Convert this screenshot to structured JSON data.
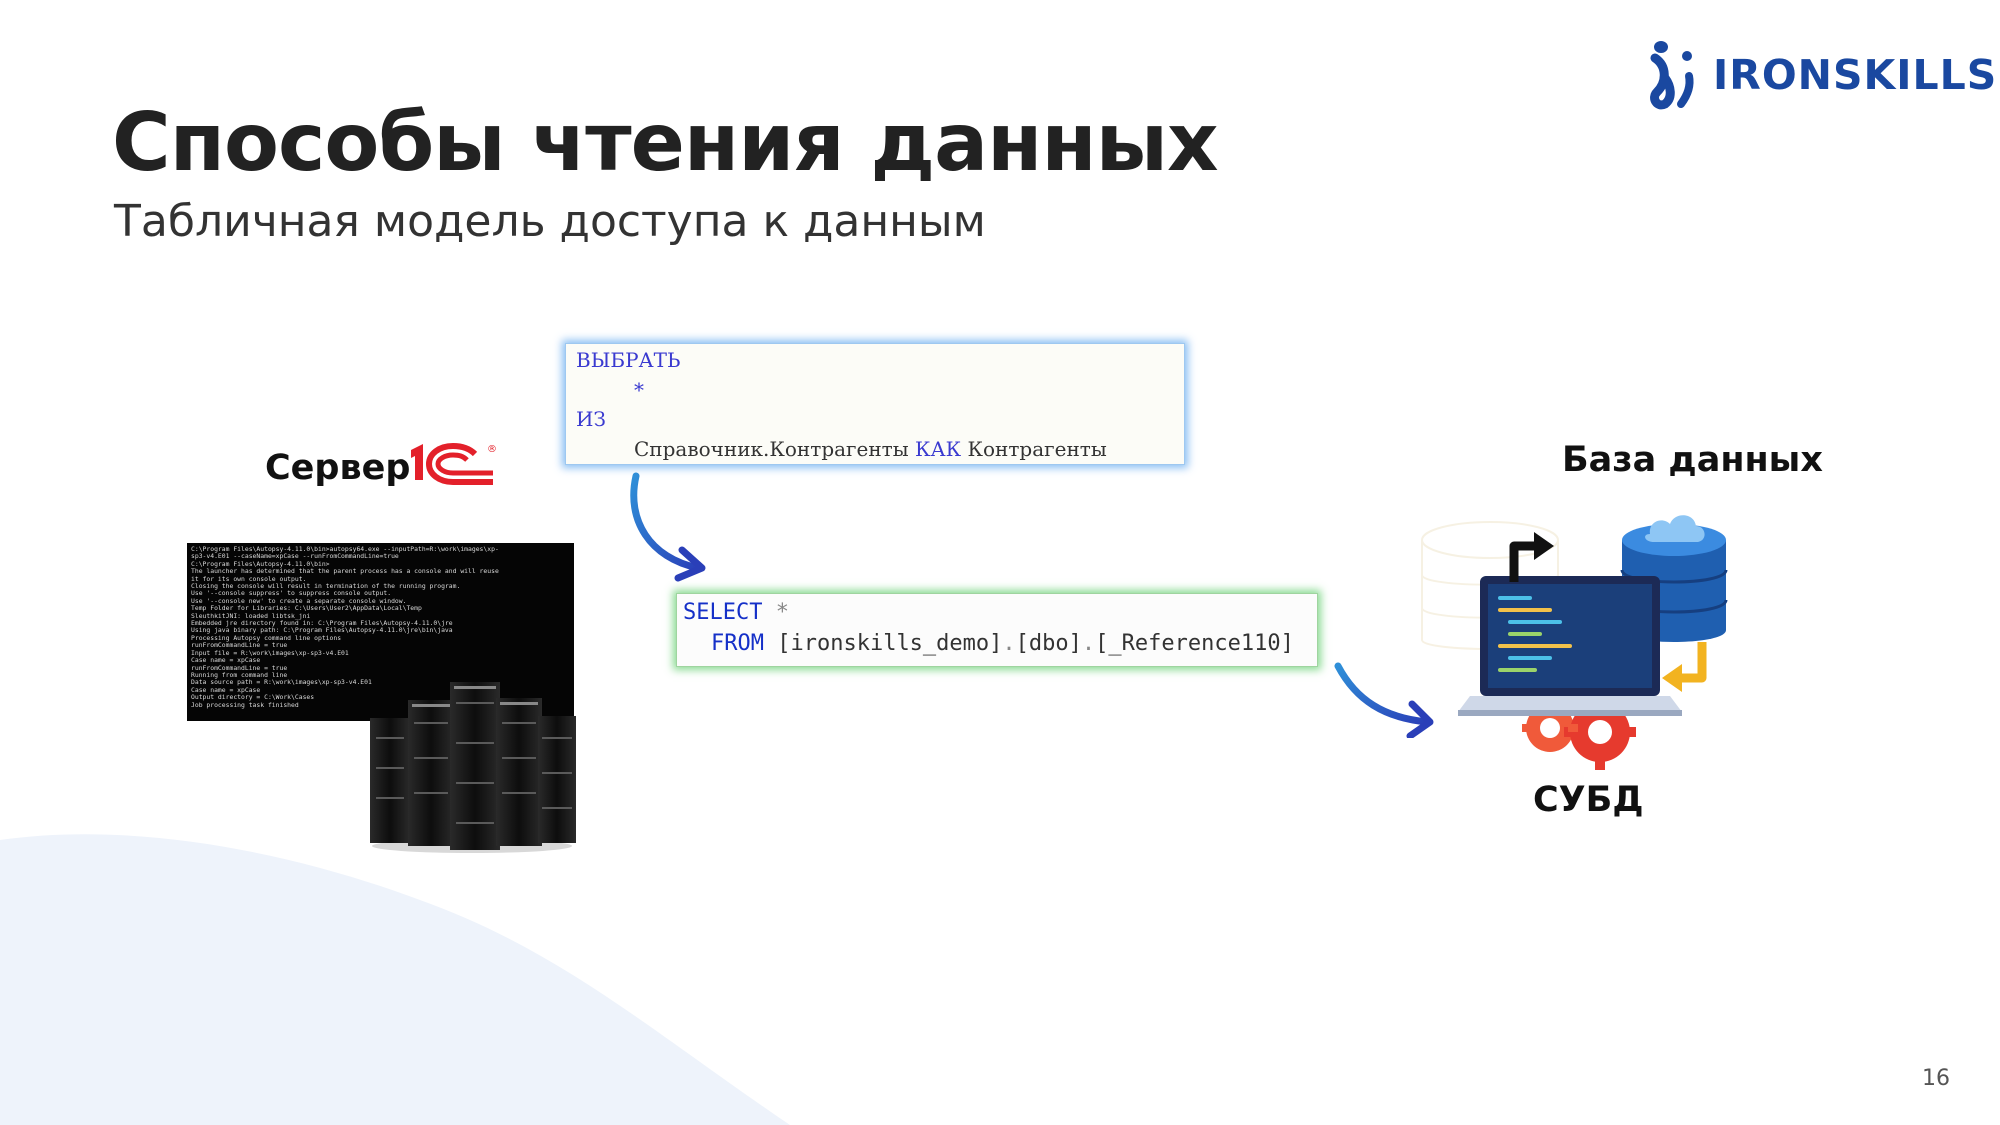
{
  "brand": {
    "name": "IRONSKILLS",
    "color": "#1a48a0"
  },
  "slide": {
    "title": "Способы чтения данных",
    "subtitle": "Табличная модель доступа к данным",
    "page_number": "16"
  },
  "labels": {
    "server": "Сервер",
    "database": "База данных",
    "dbms": "СУБД"
  },
  "logo_1c": {
    "text": "1C",
    "registered": "®",
    "color": "#e3202a"
  },
  "query_1c": {
    "line1": "ВЫБРАТЬ",
    "line2": "*",
    "line3": "ИЗ",
    "line4_source": "Справочник.Контрагенты",
    "line4_kw": "КАК",
    "line4_alias": "Контрагенты"
  },
  "query_sql": {
    "select_kw": "SELECT",
    "star": "*",
    "from_kw": "FROM",
    "db": "[ironskills_demo]",
    "dot1": ".",
    "schema": "[dbo]",
    "dot2": ".",
    "table": "[_Reference110]"
  },
  "console_lines": [
    "C:\\Program Files\\Autopsy-4.11.0\\bin>autopsy64.exe --inputPath=R:\\work\\images\\xp-",
    "sp3-v4.E01 --caseName=xpCase --runFromCommandLine=true",
    "",
    "C:\\Program Files\\Autopsy-4.11.0\\bin>",
    "",
    "The launcher has determined that the parent process has a console and will reuse",
    " it for its own console output.",
    "Closing the console will result in termination of the running program.",
    "Use '--console suppress' to suppress console output.",
    "Use '--console new' to create a separate console window.",
    "Temp Folder for Libraries: C:\\Users\\User2\\AppData\\Local\\Temp",
    "SleuthkitJNI: loaded libtsk_jni",
    "Embedded jre directory found in: C:\\Program Files\\Autopsy-4.11.0\\jre",
    "Using java binary path: C:\\Program Files\\Autopsy-4.11.0\\jre\\bin\\java",
    "Processing Autopsy command line options",
    "runFromCommandLine = true",
    "Input file = R:\\work\\images\\xp-sp3-v4.E01",
    "Case name = xpCase",
    "runFromCommandLine = true",
    "Running from command line",
    "Data source path = R:\\work\\images\\xp-sp3-v4.E01",
    "Case name = xpCase",
    "Output directory = C:\\Work\\Cases",
    "Job processing task finished"
  ],
  "icons": [
    "ironskills-logo-icon",
    "1c-logo-icon",
    "server-rack-icon",
    "database-icon",
    "laptop-icon",
    "gear-icon",
    "arrow-icon"
  ]
}
